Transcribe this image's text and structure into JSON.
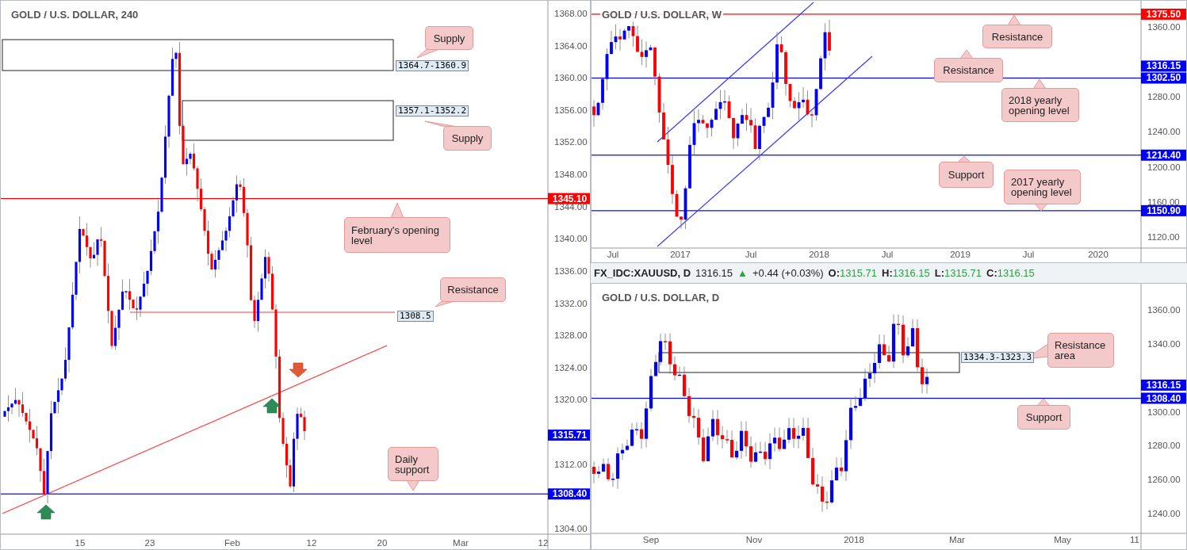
{
  "charts": [
    {
      "title": "GOLD / U.S. DOLLAR, 240",
      "price_ticks": [
        "1368.00",
        "1364.00",
        "1360.00",
        "1356.00",
        "1352.00",
        "1348.00",
        "1344.00",
        "1340.00",
        "1336.00",
        "1332.00",
        "1328.00",
        "1324.00",
        "1320.00",
        "1312.00",
        "1304.00"
      ],
      "time_ticks": [
        "15",
        "23",
        "Feb",
        "12",
        "20",
        "Mar",
        "12"
      ],
      "zones": [
        {
          "kind": "box",
          "label": "1364.7-1360.9"
        },
        {
          "kind": "box",
          "label": "1357.1-1352.2"
        },
        {
          "kind": "line",
          "label": "1308.5"
        }
      ],
      "levels": [
        {
          "text": "1345.10",
          "color": "#ff0000",
          "line": true
        },
        {
          "text": "1315.71",
          "color": "#0000ff",
          "line": false
        },
        {
          "text": "1308.40",
          "color": "#0000ff",
          "line": true
        }
      ],
      "callouts": [
        {
          "text": "Supply"
        },
        {
          "text": "Supply"
        },
        {
          "text": "February's opening level"
        },
        {
          "text": "Resistance"
        },
        {
          "text": "Daily support"
        }
      ]
    },
    {
      "title": "GOLD / U.S. DOLLAR, W",
      "price_ticks": [
        "1360.00",
        "1280.00",
        "1240.00",
        "1200.00",
        "1160.00",
        "1120.00"
      ],
      "time_ticks": [
        "Jul",
        "2017",
        "Jul",
        "2018",
        "Jul",
        "2019",
        "Jul",
        "2020"
      ],
      "levels": [
        {
          "text": "1375.50",
          "color": "#ff0000",
          "line": true
        },
        {
          "text": "1316.15",
          "color": "#0000ff",
          "line": false
        },
        {
          "text": "1302.50",
          "color": "#0000ff",
          "line": true
        },
        {
          "text": "1214.40",
          "color": "#0000ff",
          "line": true
        },
        {
          "text": "1150.90",
          "color": "#0000ff",
          "line": true
        }
      ],
      "callouts": [
        {
          "text": "Resistance"
        },
        {
          "text": "Resistance"
        },
        {
          "text": "2018 yearly opening level"
        },
        {
          "text": "Support"
        },
        {
          "text": "2017 yearly opening level"
        }
      ]
    },
    {
      "title": "GOLD / U.S. DOLLAR, D",
      "price_ticks": [
        "1360.00",
        "1340.00",
        "1300.00",
        "1280.00",
        "1260.00",
        "1240.00"
      ],
      "time_ticks": [
        "Sep",
        "Nov",
        "2018",
        "Mar",
        "May",
        "11"
      ],
      "zones": [
        {
          "kind": "box",
          "label": "1334.3-1323.3"
        }
      ],
      "levels": [
        {
          "text": "1316.15",
          "color": "#0000ff",
          "line": false
        },
        {
          "text": "1308.40",
          "color": "#0000ff",
          "line": true
        }
      ],
      "callouts": [
        {
          "text": "Resistance area"
        },
        {
          "text": "Support"
        }
      ]
    }
  ],
  "quote": {
    "symbol": "FX_IDC:XAUUSD, D",
    "price": "1316.15",
    "arrow": "▲",
    "change": "+0.44 (+0.03%)",
    "ohlc": [
      {
        "label": "O:",
        "value": "1315.71"
      },
      {
        "label": "H:",
        "value": "1316.15"
      },
      {
        "label": "L:",
        "value": "1315.71"
      },
      {
        "label": "C:",
        "value": "1316.15"
      }
    ]
  }
}
